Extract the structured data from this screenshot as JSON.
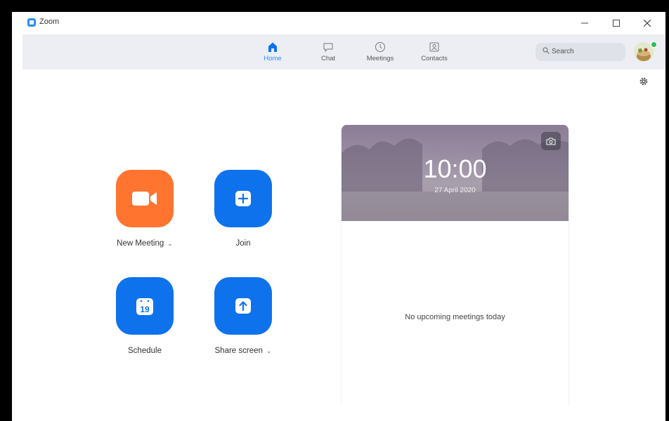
{
  "window": {
    "title": "Zoom",
    "minimize_icon": "minimize-icon",
    "maximize_icon": "maximize-icon",
    "close_icon": "close-icon"
  },
  "nav": {
    "tabs": [
      {
        "label": "Home",
        "icon": "home-icon",
        "active": true
      },
      {
        "label": "Chat",
        "icon": "chat-icon",
        "active": false
      },
      {
        "label": "Meetings",
        "icon": "clock-icon",
        "active": false
      },
      {
        "label": "Contacts",
        "icon": "contacts-icon",
        "active": false
      }
    ],
    "search_placeholder": "Search",
    "accent": "#2d8cff"
  },
  "actions": [
    {
      "label": "New Meeting",
      "icon": "video-camera-icon",
      "color": "#ff742e",
      "has_dropdown": true
    },
    {
      "label": "Join",
      "icon": "plus-icon",
      "color": "#0e72ed",
      "has_dropdown": false
    },
    {
      "label": "Schedule",
      "icon": "calendar-icon",
      "color": "#0e72ed",
      "has_dropdown": false,
      "icon_text": "19"
    },
    {
      "label": "Share screen",
      "icon": "share-up-arrow-icon",
      "color": "#0e72ed",
      "has_dropdown": true
    }
  ],
  "calendar": {
    "time": "10:00",
    "date": "27 April 2020",
    "empty_message": "No upcoming meetings today"
  }
}
